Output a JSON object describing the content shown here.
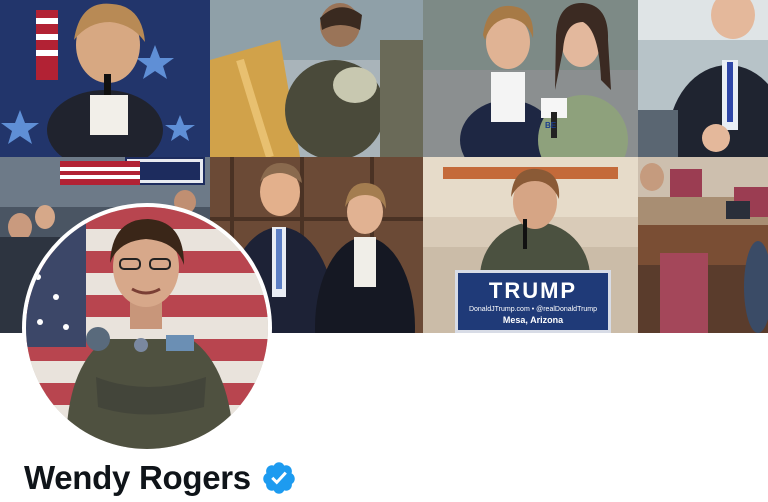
{
  "profile": {
    "display_name": "Wendy Rogers",
    "verified_badge": "verified-badge-icon"
  },
  "banner": {
    "rally_sign": {
      "headline": "TRUMP",
      "websites": "DonaldJTrump.com • @realDonaldTrump",
      "location": "Mesa, Arizona"
    },
    "mic_flag": "BE"
  },
  "colors": {
    "verified_blue": "#1d9bf0",
    "name_text": "#0f1419",
    "sign_blue": "#1f3a78"
  }
}
